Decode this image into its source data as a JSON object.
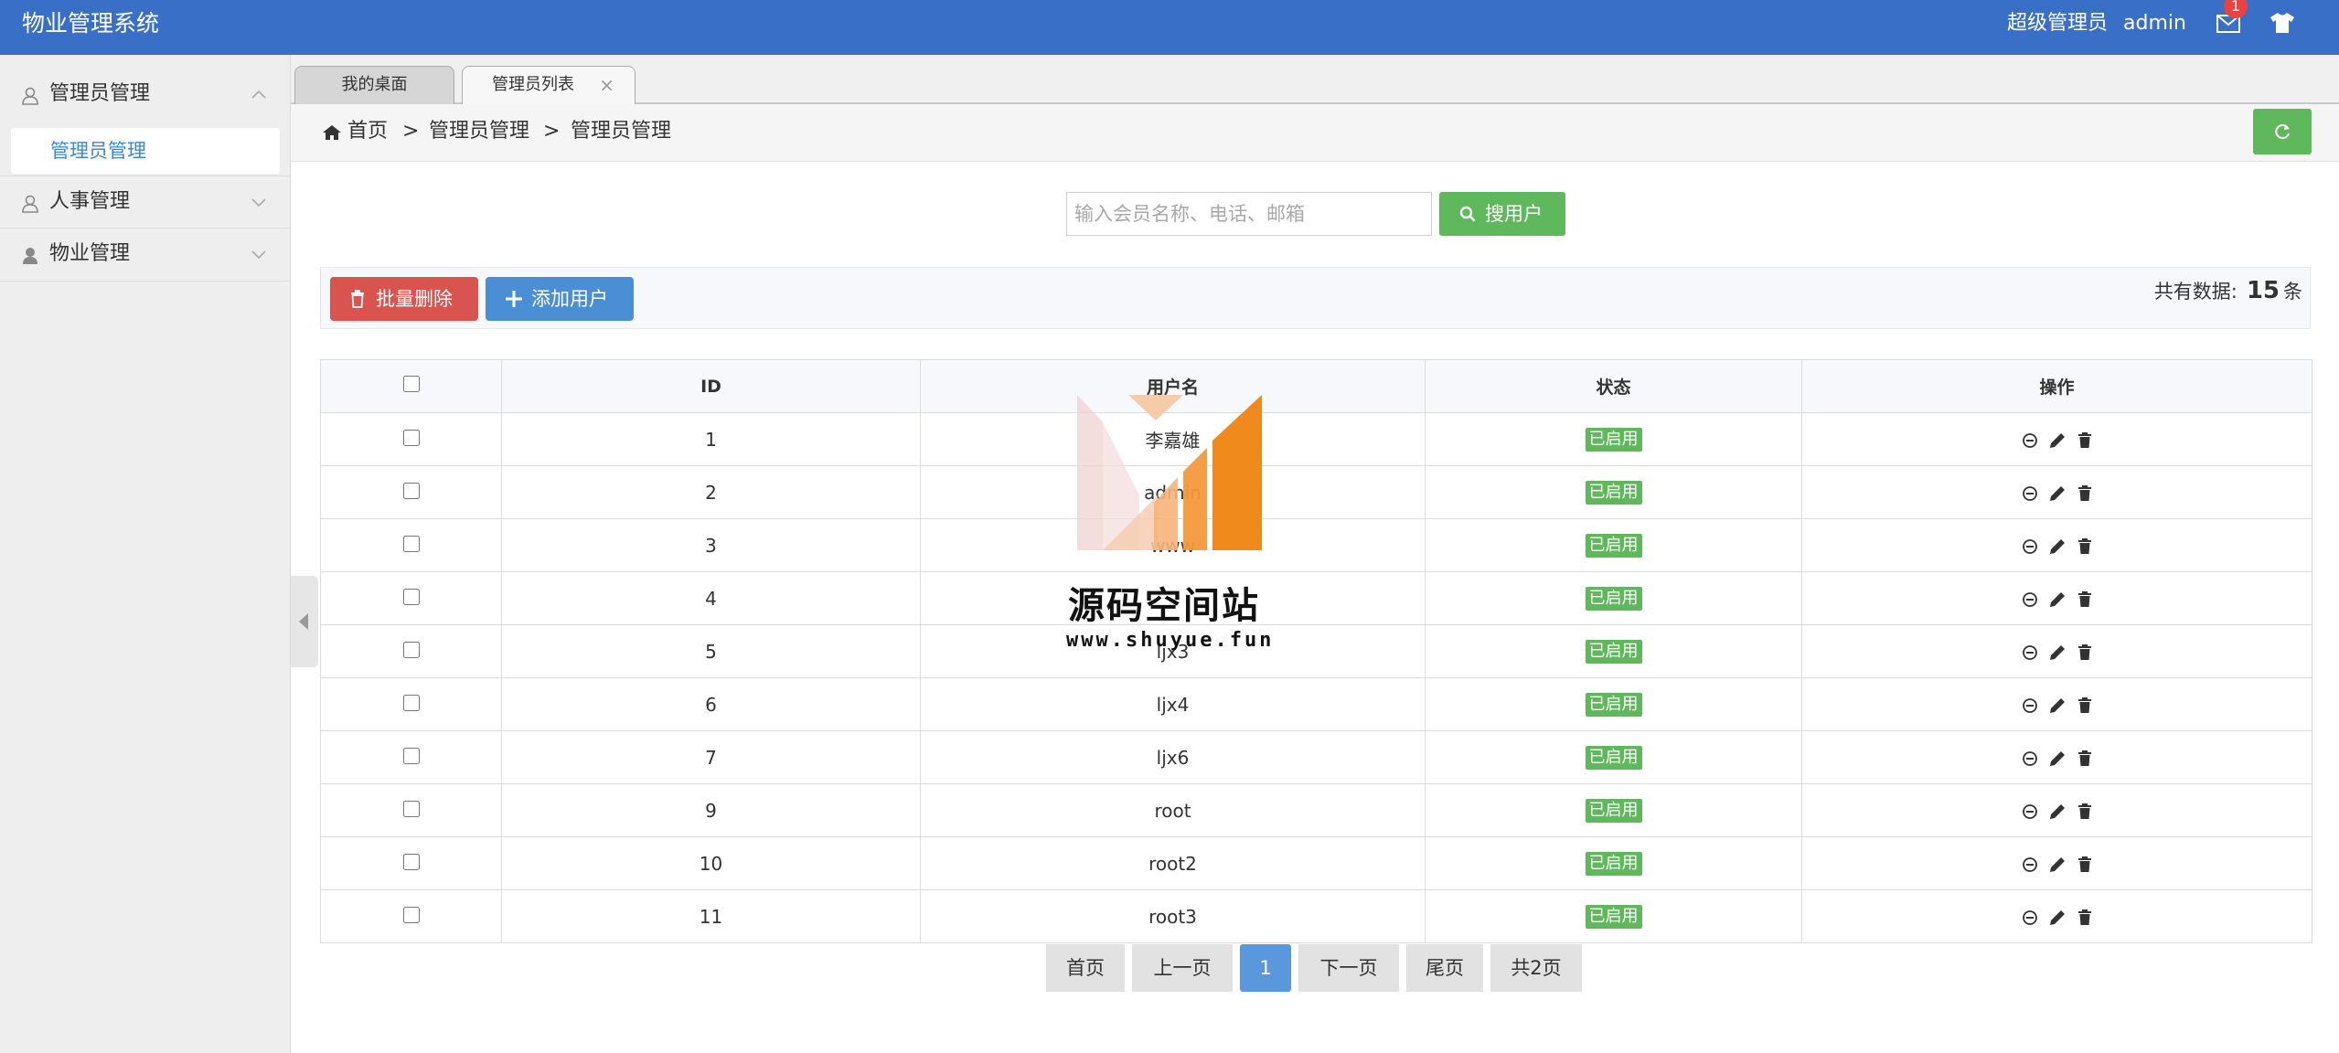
{
  "header": {
    "app_title": "物业管理系统",
    "user_role": "超级管理员",
    "user_name": "admin",
    "mail_badge": "1",
    "accent_color": "#3a6fc8"
  },
  "sidebar": {
    "groups": [
      {
        "label": "管理员管理",
        "icon": "user-outline-icon",
        "expanded": true
      },
      {
        "label": "人事管理",
        "icon": "user-outline-icon",
        "expanded": false
      },
      {
        "label": "物业管理",
        "icon": "user-solid-icon",
        "expanded": false
      }
    ],
    "active_item": "管理员管理"
  },
  "tabs": [
    {
      "label": "我的桌面",
      "active": false
    },
    {
      "label": "管理员列表",
      "active": true,
      "close": "×"
    }
  ],
  "breadcrumb": {
    "items": [
      "首页",
      "管理员管理",
      "管理员管理"
    ],
    "separator": ">"
  },
  "search": {
    "placeholder": "输入会员名称、电话、邮箱",
    "value": "",
    "button_label": "搜用户"
  },
  "toolbar": {
    "delete_label": "批量删除",
    "add_label": "添加用户",
    "total_prefix": "共有数据:",
    "total_count": "15",
    "total_suffix": "条"
  },
  "table": {
    "headers": [
      "ID",
      "用户名",
      "状态",
      "操作"
    ],
    "rows": [
      {
        "id": "1",
        "username": "李嘉雄",
        "status": "已启用"
      },
      {
        "id": "2",
        "username": "admin",
        "status": "已启用"
      },
      {
        "id": "3",
        "username": "www",
        "status": "已启用"
      },
      {
        "id": "4",
        "username": "",
        "status": "已启用"
      },
      {
        "id": "5",
        "username": "ljx3",
        "status": "已启用"
      },
      {
        "id": "6",
        "username": "ljx4",
        "status": "已启用"
      },
      {
        "id": "7",
        "username": "ljx6",
        "status": "已启用"
      },
      {
        "id": "9",
        "username": "root",
        "status": "已启用"
      },
      {
        "id": "10",
        "username": "root2",
        "status": "已启用"
      },
      {
        "id": "11",
        "username": "root3",
        "status": "已启用"
      }
    ],
    "status_color": "#5fb85c"
  },
  "pagination": {
    "first": "首页",
    "prev": "上一页",
    "current": "1",
    "next": "下一页",
    "last": "尾页",
    "total_pages": "共2页"
  },
  "watermark": {
    "title": "源码空间站",
    "url": "www.shuyue.fun"
  }
}
